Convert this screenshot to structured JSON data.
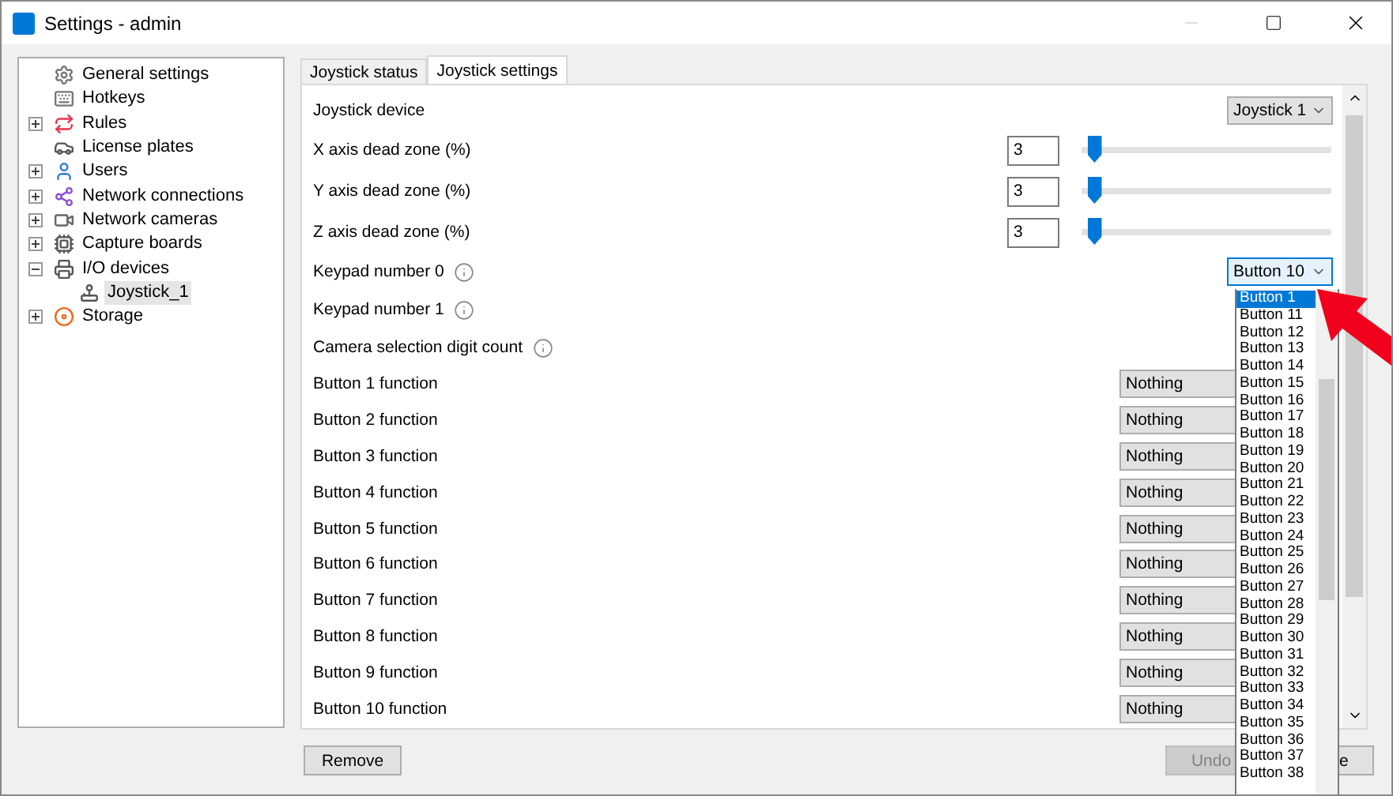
{
  "window": {
    "title": "Settings - admin"
  },
  "tree": [
    {
      "label": "General settings",
      "selected": false
    },
    {
      "label": "Hotkeys",
      "selected": false
    },
    {
      "label": "Rules",
      "selected": false,
      "expanded": false
    },
    {
      "label": "License plates",
      "selected": false
    },
    {
      "label": "Users",
      "selected": false,
      "expanded": false
    },
    {
      "label": "Network connections",
      "selected": false,
      "expanded": false
    },
    {
      "label": "Network cameras",
      "selected": false,
      "expanded": false
    },
    {
      "label": "Capture boards",
      "selected": false,
      "expanded": false
    },
    {
      "label": "I/O devices",
      "selected": false,
      "expanded": true,
      "children": [
        {
          "label": "Joystick_1",
          "selected": true
        }
      ]
    },
    {
      "label": "Storage",
      "selected": false,
      "expanded": false
    }
  ],
  "tabs": [
    {
      "label": "Joystick status",
      "selected": false
    },
    {
      "label": "Joystick settings",
      "selected": true
    }
  ],
  "settings": [
    {
      "kind": "combo",
      "label": "Joystick device",
      "value": "Joystick 1"
    },
    {
      "kind": "slider",
      "label": "X axis dead zone (%)",
      "value": "3",
      "level": 0.03
    },
    {
      "kind": "slider",
      "label": "Y axis dead zone (%)",
      "value": "3",
      "level": 0.03
    },
    {
      "kind": "slider",
      "label": "Z axis dead zone (%)",
      "value": "3",
      "level": 0.03
    },
    {
      "kind": "info",
      "label": "Keypad number 0"
    },
    {
      "kind": "info",
      "label": "Keypad number 1"
    },
    {
      "kind": "info",
      "label": "Camera selection digit count"
    },
    {
      "kind": "function",
      "label": "Button 1 function",
      "value": "Nothing"
    },
    {
      "kind": "function",
      "label": "Button 2 function",
      "value": "Nothing"
    },
    {
      "kind": "function",
      "label": "Button 3 function",
      "value": "Nothing"
    },
    {
      "kind": "function",
      "label": "Button 4 function",
      "value": "Nothing"
    },
    {
      "kind": "function",
      "label": "Button 5 function",
      "value": "Nothing"
    },
    {
      "kind": "function",
      "label": "Button 6 function",
      "value": "Nothing"
    },
    {
      "kind": "function",
      "label": "Button 7 function",
      "value": "Nothing"
    },
    {
      "kind": "function",
      "label": "Button 8 function",
      "value": "Nothing"
    },
    {
      "kind": "function",
      "label": "Button 9 function",
      "value": "Nothing"
    },
    {
      "kind": "function",
      "label": "Button 10 function",
      "value": "Nothing"
    }
  ],
  "open_dropdown": {
    "value": "Button 10",
    "items": [
      {
        "label": "Button 1",
        "selected": true
      },
      {
        "label": "Button 11",
        "selected": false
      },
      {
        "label": "Button 12",
        "selected": false
      },
      {
        "label": "Button 13",
        "selected": false
      },
      {
        "label": "Button 14",
        "selected": false
      },
      {
        "label": "Button 15",
        "selected": false
      },
      {
        "label": "Button 16",
        "selected": false
      },
      {
        "label": "Button 17",
        "selected": false
      },
      {
        "label": "Button 18",
        "selected": false
      },
      {
        "label": "Button 19",
        "selected": false
      },
      {
        "label": "Button 20",
        "selected": false
      },
      {
        "label": "Button 21",
        "selected": false
      },
      {
        "label": "Button 22",
        "selected": false
      },
      {
        "label": "Button 23",
        "selected": false
      },
      {
        "label": "Button 24",
        "selected": false
      },
      {
        "label": "Button 25",
        "selected": false
      },
      {
        "label": "Button 26",
        "selected": false
      },
      {
        "label": "Button 27",
        "selected": false
      },
      {
        "label": "Button 28",
        "selected": false
      },
      {
        "label": "Button 29",
        "selected": false
      },
      {
        "label": "Button 30",
        "selected": false
      },
      {
        "label": "Button 31",
        "selected": false
      },
      {
        "label": "Button 32",
        "selected": false
      },
      {
        "label": "Button 33",
        "selected": false
      },
      {
        "label": "Button 34",
        "selected": false
      },
      {
        "label": "Button 35",
        "selected": false
      },
      {
        "label": "Button 36",
        "selected": false
      },
      {
        "label": "Button 37",
        "selected": false
      },
      {
        "label": "Button 38",
        "selected": false
      }
    ]
  },
  "buttons": [
    {
      "label": "Remove",
      "disabled": false
    },
    {
      "label": "Undo",
      "disabled": true
    },
    {
      "label": "e",
      "disabled": false
    }
  ]
}
